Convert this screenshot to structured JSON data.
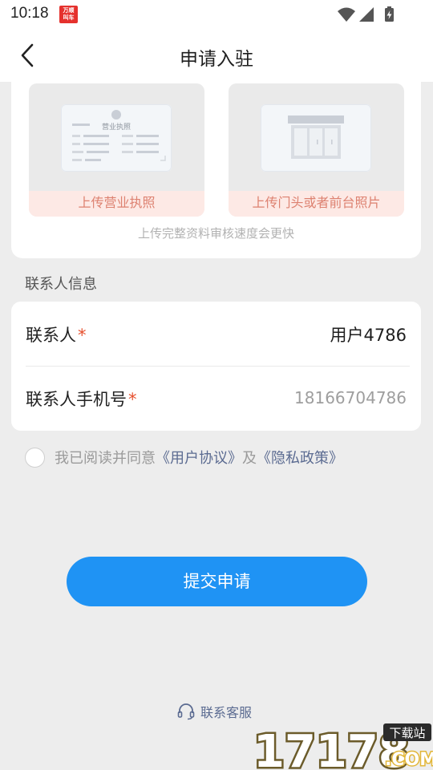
{
  "status_bar": {
    "time": "10:18",
    "app_badge_line1": "万顺",
    "app_badge_line2": "叫车",
    "icons": [
      "wifi-icon",
      "signal-icon",
      "battery-charging-icon"
    ]
  },
  "header": {
    "title": "申请入驻",
    "back_icon": "chevron-left-icon"
  },
  "upload": {
    "license_caption": "上传营业执照",
    "storefront_caption": "上传门头或者前台照片",
    "hint": "上传完整资料审核速度会更快",
    "license_image_text": "营业执照"
  },
  "contact": {
    "section_label": "联系人信息",
    "name_label": "联系人",
    "name_value": "用户4786",
    "phone_label": "联系人手机号",
    "phone_value": "18166704786",
    "required_mark": "*"
  },
  "agreement": {
    "prefix": "我已阅读并同意",
    "user_agreement": "《用户协议》",
    "connector": "及",
    "privacy_policy": "《隐私政策》",
    "checked": false
  },
  "actions": {
    "submit_label": "提交申请",
    "support_label": "联系客服",
    "support_icon": "headset-icon"
  },
  "watermark": {
    "text": "17178",
    "badge": "下载站",
    "suffix": ".COM"
  },
  "colors": {
    "primary": "#1f93f4",
    "required": "#e6502e",
    "link": "#5b6b91",
    "caption_bg": "#fde9e5",
    "caption_text": "#dd8170"
  }
}
